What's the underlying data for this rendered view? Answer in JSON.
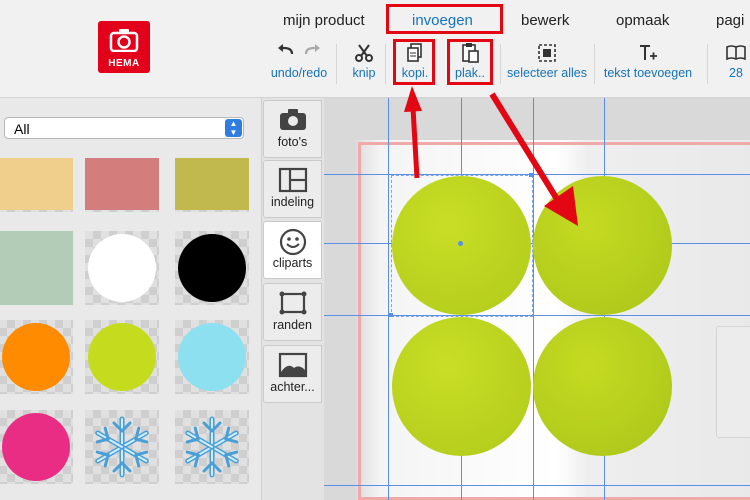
{
  "brand": {
    "logo_text": "HEMA"
  },
  "menu": {
    "tabs": [
      {
        "label": "mijn product"
      },
      {
        "label": "invoegen"
      },
      {
        "label": "bewerk"
      },
      {
        "label": "opmaak"
      },
      {
        "label": "pagi"
      }
    ],
    "active_tab": "invoegen"
  },
  "toolbar": {
    "undo_redo": "undo/redo",
    "knip": "knip",
    "kopi": "kopi.",
    "plak": "plak..",
    "selecteer_alles": "selecteer alles",
    "tekst_toevoegen": "tekst toevoegen",
    "pages": "28"
  },
  "sidebar": {
    "filter": {
      "selected": "All"
    },
    "cliparts": [
      {
        "shape": "rect",
        "color": "#f0cf8c"
      },
      {
        "shape": "rect",
        "color": "#d47d7d"
      },
      {
        "shape": "rect",
        "color": "#c1b84e"
      },
      {
        "shape": "rect",
        "color": "#b3ccb7"
      },
      {
        "shape": "circle",
        "color": "#ffffff"
      },
      {
        "shape": "circle",
        "color": "#000000"
      },
      {
        "shape": "circle",
        "color": "#ff8c00"
      },
      {
        "shape": "circle",
        "color": "#c5dc1e"
      },
      {
        "shape": "circle",
        "color": "#8de0f0"
      },
      {
        "shape": "circle",
        "color": "#ea2d84"
      },
      {
        "shape": "snowflake",
        "color": "#7fc7ee"
      },
      {
        "shape": "snowflake",
        "color": "#7fc7ee"
      }
    ]
  },
  "panel_tabs": [
    {
      "label": "foto's",
      "icon": "camera-icon"
    },
    {
      "label": "indeling",
      "icon": "layout-icon"
    },
    {
      "label": "cliparts",
      "icon": "smiley-icon"
    },
    {
      "label": "randen",
      "icon": "frame-icon"
    },
    {
      "label": "achter...",
      "icon": "background-icon"
    }
  ],
  "colors": {
    "accent": "#1673b8",
    "highlight": "#e30613",
    "circle_green": "#bfd621"
  }
}
